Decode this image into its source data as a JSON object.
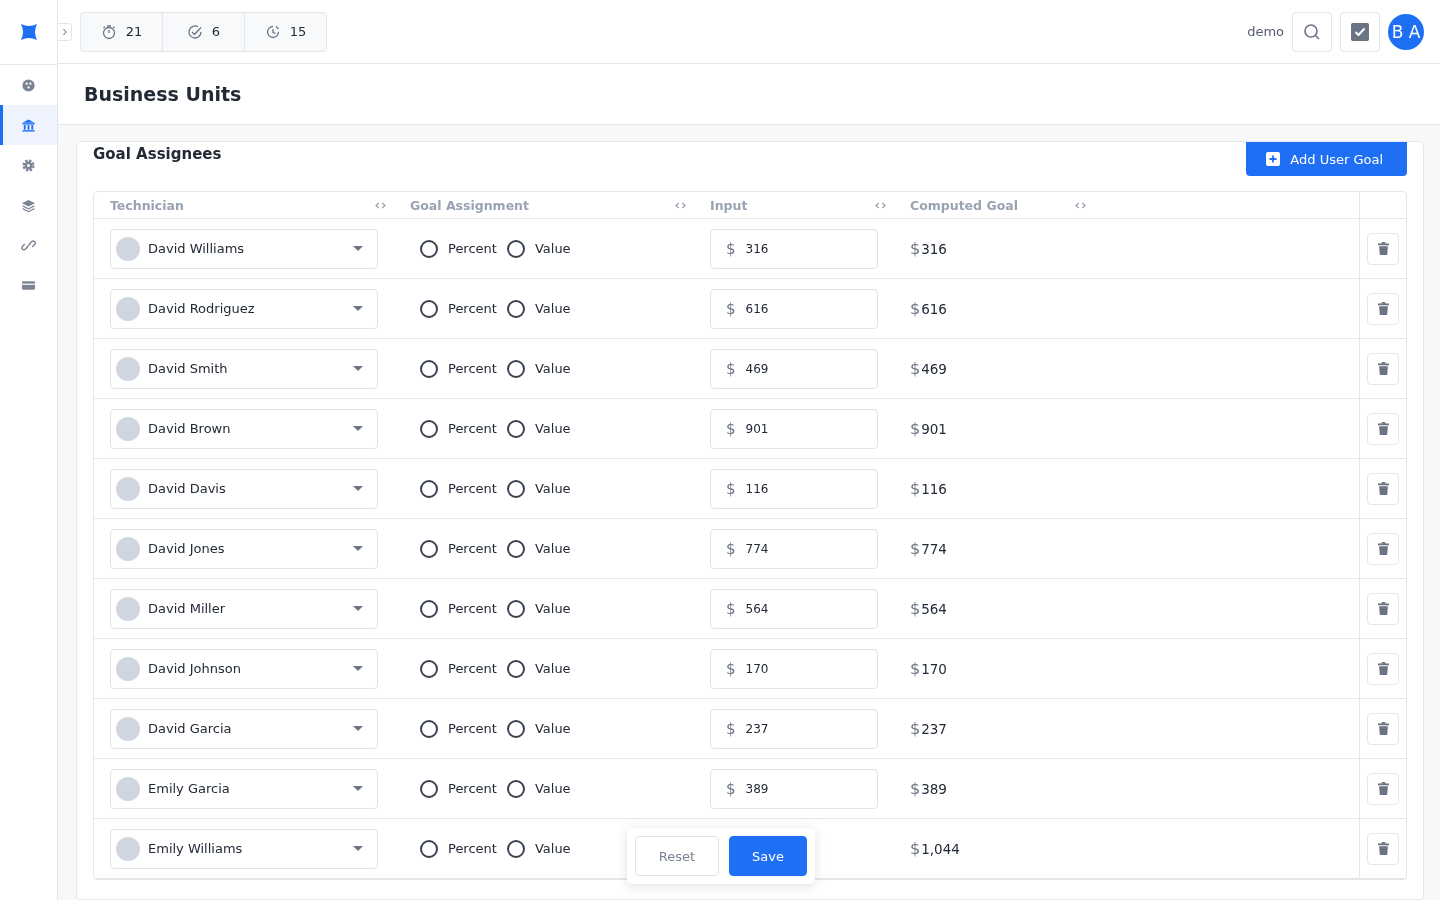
{
  "topbar": {
    "counters": [
      {
        "kind": "timer",
        "value": "21"
      },
      {
        "kind": "done",
        "value": "6"
      },
      {
        "kind": "pending",
        "value": "15"
      }
    ],
    "user_name": "demo",
    "avatar_initials": "B A"
  },
  "sidebar": {
    "items": [
      {
        "kind": "palette",
        "selected": false
      },
      {
        "kind": "bank",
        "selected": true
      },
      {
        "kind": "gear",
        "selected": false
      },
      {
        "kind": "layers",
        "selected": false
      },
      {
        "kind": "link",
        "selected": false
      },
      {
        "kind": "card",
        "selected": false
      }
    ]
  },
  "page": {
    "title": "Business Units"
  },
  "panel": {
    "title": "Goal Assignees",
    "add_button": "Add User Goal",
    "table": {
      "columns": [
        "Technician",
        "Goal Assignment",
        "Input",
        "Computed Goal"
      ],
      "rows": [
        {
          "technician": "David Williams",
          "options": [
            {
              "label": "Percent",
              "selected": false
            },
            {
              "label": "Value",
              "selected": false
            }
          ],
          "currency": "$",
          "input": "316",
          "computed_currency": "$",
          "computed": "316"
        },
        {
          "technician": "David Rodriguez",
          "options": [
            {
              "label": "Percent",
              "selected": false
            },
            {
              "label": "Value",
              "selected": false
            }
          ],
          "currency": "$",
          "input": "616",
          "computed_currency": "$",
          "computed": "616"
        },
        {
          "technician": "David Smith",
          "options": [
            {
              "label": "Percent",
              "selected": false
            },
            {
              "label": "Value",
              "selected": false
            }
          ],
          "currency": "$",
          "input": "469",
          "computed_currency": "$",
          "computed": "469"
        },
        {
          "technician": "David Brown",
          "options": [
            {
              "label": "Percent",
              "selected": false
            },
            {
              "label": "Value",
              "selected": false
            }
          ],
          "currency": "$",
          "input": "901",
          "computed_currency": "$",
          "computed": "901"
        },
        {
          "technician": "David Davis",
          "options": [
            {
              "label": "Percent",
              "selected": false
            },
            {
              "label": "Value",
              "selected": false
            }
          ],
          "currency": "$",
          "input": "116",
          "computed_currency": "$",
          "computed": "116"
        },
        {
          "technician": "David Jones",
          "options": [
            {
              "label": "Percent",
              "selected": false
            },
            {
              "label": "Value",
              "selected": false
            }
          ],
          "currency": "$",
          "input": "774",
          "computed_currency": "$",
          "computed": "774"
        },
        {
          "technician": "David Miller",
          "options": [
            {
              "label": "Percent",
              "selected": false
            },
            {
              "label": "Value",
              "selected": false
            }
          ],
          "currency": "$",
          "input": "564",
          "computed_currency": "$",
          "computed": "564"
        },
        {
          "technician": "David Johnson",
          "options": [
            {
              "label": "Percent",
              "selected": false
            },
            {
              "label": "Value",
              "selected": false
            }
          ],
          "currency": "$",
          "input": "170",
          "computed_currency": "$",
          "computed": "170"
        },
        {
          "technician": "David Garcia",
          "options": [
            {
              "label": "Percent",
              "selected": false
            },
            {
              "label": "Value",
              "selected": false
            }
          ],
          "currency": "$",
          "input": "237",
          "computed_currency": "$",
          "computed": "237"
        },
        {
          "technician": "Emily Garcia",
          "options": [
            {
              "label": "Percent",
              "selected": false
            },
            {
              "label": "Value",
              "selected": false
            }
          ],
          "currency": "$",
          "input": "389",
          "computed_currency": "$",
          "computed": "389"
        },
        {
          "technician": "Emily Williams",
          "options": [
            {
              "label": "Percent",
              "selected": false
            },
            {
              "label": "Value",
              "selected": false
            }
          ],
          "computed_currency": "$",
          "computed": "1,044"
        }
      ]
    }
  },
  "action_bar": {
    "buttons": [
      "Reset",
      "Save"
    ]
  }
}
